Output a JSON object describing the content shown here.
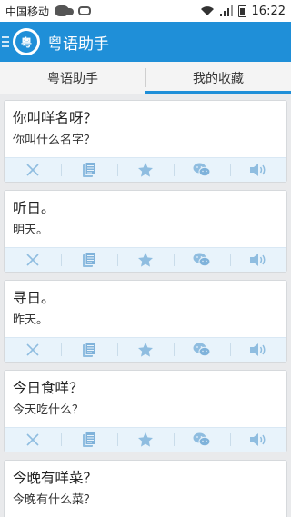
{
  "status_bar": {
    "carrier": "中国移动",
    "time": "16:22"
  },
  "app_bar": {
    "logo_char": "粤",
    "title": "粤语助手"
  },
  "tabs": [
    {
      "label": "粤语助手",
      "active": false
    },
    {
      "label": "我的收藏",
      "active": true
    }
  ],
  "phrases": [
    {
      "cantonese": "你叫咩名呀？",
      "mandarin": "你叫什么名字？"
    },
    {
      "cantonese": "听日。",
      "mandarin": "明天。"
    },
    {
      "cantonese": "寻日。",
      "mandarin": "昨天。"
    },
    {
      "cantonese": "今日食咩？",
      "mandarin": "今天吃什么？"
    },
    {
      "cantonese": "今晚有咩菜？",
      "mandarin": "今晚有什么菜？"
    }
  ],
  "action_icons": [
    "delete-icon",
    "copy-icon",
    "star-icon",
    "wechat-share-icon",
    "speaker-icon"
  ],
  "colors": {
    "accent": "#1f8fd8",
    "action_icon": "#8fbde0",
    "action_bar": "#e8f3fb"
  }
}
